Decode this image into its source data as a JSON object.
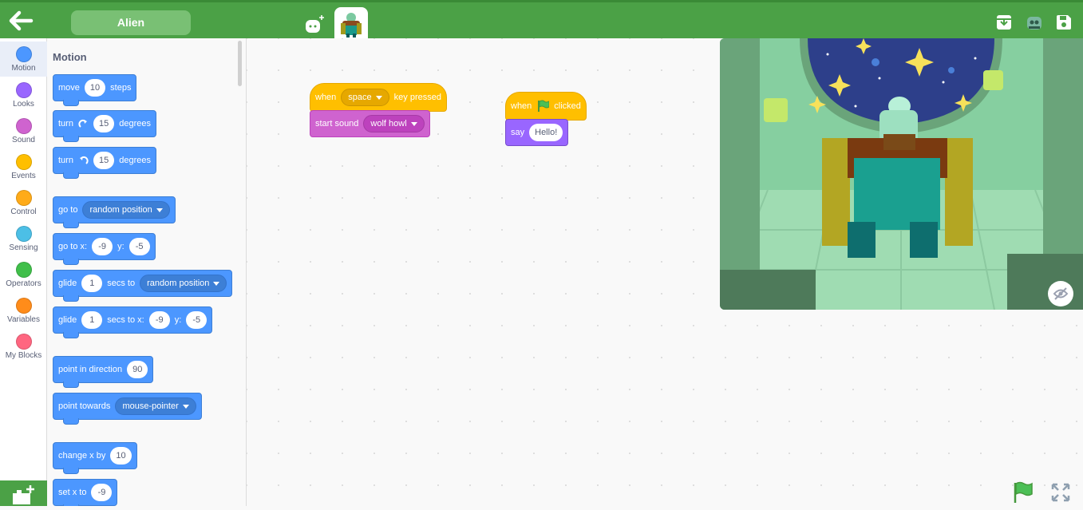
{
  "topbar": {
    "sprite_name": "Alien"
  },
  "categories": [
    {
      "label": "Motion",
      "color": "#4c97ff"
    },
    {
      "label": "Looks",
      "color": "#9966ff"
    },
    {
      "label": "Sound",
      "color": "#cf63cf"
    },
    {
      "label": "Events",
      "color": "#ffbf00"
    },
    {
      "label": "Control",
      "color": "#ffab19"
    },
    {
      "label": "Sensing",
      "color": "#4cbfe6"
    },
    {
      "label": "Operators",
      "color": "#40bf4a"
    },
    {
      "label": "Variables",
      "color": "#ff8c1a"
    },
    {
      "label": "My Blocks",
      "color": "#ff6680"
    }
  ],
  "palette": {
    "title": "Motion",
    "move": {
      "pre": "move",
      "val": "10",
      "post": "steps"
    },
    "turn_right": {
      "pre": "turn",
      "val": "15",
      "post": "degrees"
    },
    "turn_left": {
      "pre": "turn",
      "val": "15",
      "post": "degrees"
    },
    "goto": {
      "pre": "go to",
      "opt": "random position"
    },
    "goto_xy": {
      "pre": "go to x:",
      "x": "-9",
      "ylbl": "y:",
      "y": "-5"
    },
    "glide_to": {
      "pre": "glide",
      "val": "1",
      "mid": "secs to",
      "opt": "random position"
    },
    "glide_xy": {
      "pre": "glide",
      "val": "1",
      "mid": "secs to x:",
      "x": "-9",
      "ylbl": "y:",
      "y": "-5"
    },
    "point_dir": {
      "pre": "point in direction",
      "val": "90"
    },
    "point_towards": {
      "pre": "point towards",
      "opt": "mouse-pointer"
    },
    "change_x": {
      "pre": "change x by",
      "val": "10"
    },
    "set_x": {
      "pre": "set x to",
      "val": "-9"
    }
  },
  "workspace": {
    "script1": {
      "hat_pre": "when",
      "hat_key": "space",
      "hat_post": "key pressed",
      "sound_pre": "start sound",
      "sound_opt": "wolf howl"
    },
    "script2": {
      "hat_pre": "when",
      "hat_post": "clicked",
      "say_pre": "say",
      "say_val": "Hello!"
    }
  }
}
